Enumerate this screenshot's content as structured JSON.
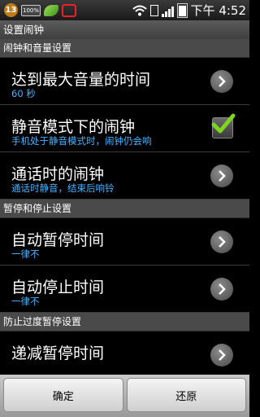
{
  "status_bar": {
    "badge_count": "13",
    "battery_small_label": "100%",
    "time": "下午 4:52"
  },
  "title": "设置闹钟",
  "sections": [
    {
      "header": "闹钟和音量设置",
      "items": [
        {
          "title": "达到最大音量的时间",
          "subtitle": "60 秒",
          "control": "chevron"
        },
        {
          "title": "静音模式下的闹钟",
          "subtitle": "手机处于静音模式时，闹钟仍会响",
          "control": "checkbox",
          "checked": true
        },
        {
          "title": "通话时的闹钟",
          "subtitle": "通话时静音，结束后响铃",
          "control": "chevron"
        }
      ]
    },
    {
      "header": "暂停和停止设置",
      "items": [
        {
          "title": "自动暂停时间",
          "subtitle": "一律不",
          "control": "chevron"
        },
        {
          "title": "自动停止时间",
          "subtitle": "一律不",
          "control": "chevron"
        }
      ]
    },
    {
      "header": "防止过度暂停设置",
      "items": [
        {
          "title": "递减暂停时间",
          "subtitle": "",
          "control": "chevron"
        }
      ]
    }
  ],
  "buttons": {
    "confirm": "确定",
    "revert": "还原"
  },
  "colors": {
    "subtitle": "#4ab3ff",
    "check": "#7fd321"
  }
}
